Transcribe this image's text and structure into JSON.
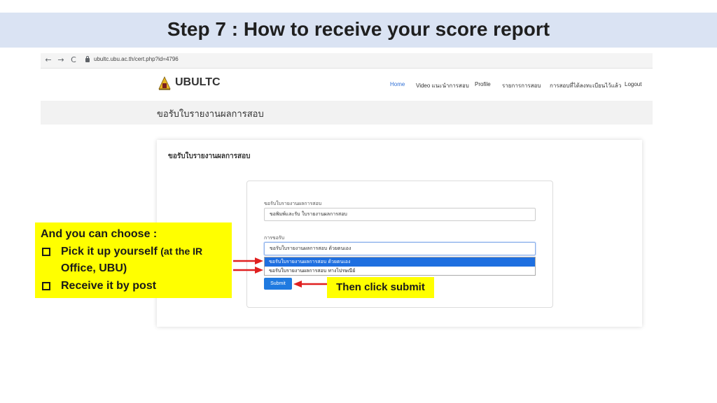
{
  "slide": {
    "title": "Step 7 : How to receive your score report"
  },
  "browser": {
    "back_icon": "←",
    "forward_icon": "→",
    "reload_icon": "C",
    "url": "ubultc.ubu.ac.th/cert.php?id=4796"
  },
  "site": {
    "brand": "UBULTC",
    "nav": [
      "Home",
      "Video แนะนำการสอบ",
      "Profile",
      "รายการการสอบ",
      "การสอบที่ได้ลงทะเบียนไว้แล้ว",
      "Logout"
    ],
    "accent_color": "#2f6fd6"
  },
  "page": {
    "title": "ขอรับใบรายงานผลการสอบ"
  },
  "form": {
    "heading": "ขอรับใบรายงานผลการสอบ",
    "field1_label": "ขอรับใบรายงานผลการสอบ",
    "field1_value": "ขอพิมพ์และรับ ใบรายงานผลการสอบ",
    "field2_label": "การขอรับ",
    "field2_value": "ขอรับใบรายงานผลการสอบ ด้วยตนเอง",
    "options": [
      "ขอรับใบรายงานผลการสอบ ด้วยตนเอง",
      "ขอรับใบรายงานผลการสอบ ทางไปรษณีย์"
    ],
    "submit_label": "Submit",
    "submit_color": "#1f7ae0"
  },
  "callout": {
    "heading": "And you can choose :",
    "item1_main": "Pick it up yourself",
    "item1_small": "(at the IR",
    "item1_cont": "Office, UBU)",
    "item2": "Receive it by post",
    "color": "#ffff00"
  },
  "submit_callout": {
    "text": "Then click submit"
  },
  "arrow_color": "#e02020"
}
